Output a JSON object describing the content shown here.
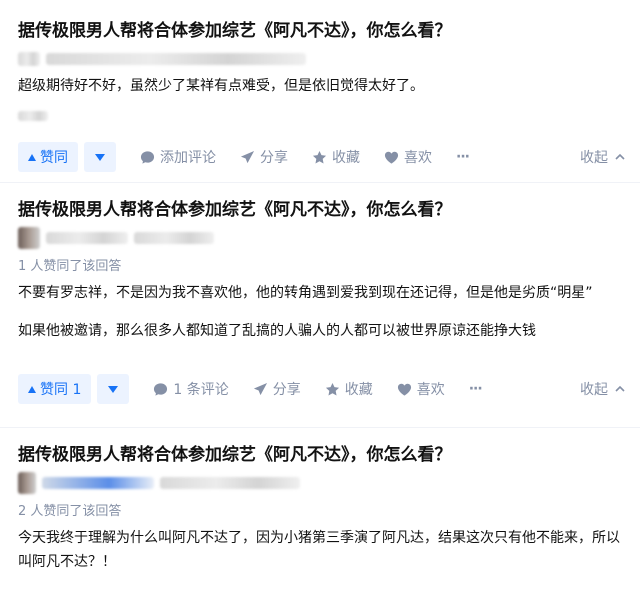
{
  "cards": [
    {
      "question": "据传极限男人帮将合体参加综艺《阿凡不达》，你怎么看？",
      "voters": "",
      "content": [
        "超级期待好不好，虽然少了某祥有点难受，但是依旧觉得太好了。"
      ],
      "actions": {
        "upvote": "赞同",
        "comment": "添加评论",
        "share": "分享",
        "favorite": "收藏",
        "like": "喜欢",
        "more": "···",
        "collapse": "收起"
      }
    },
    {
      "question": "据传极限男人帮将合体参加综艺《阿凡不达》，你怎么看？",
      "voters": "1 人赞同了该回答",
      "content": [
        "不要有罗志祥，不是因为我不喜欢他，他的转角遇到爱我到现在还记得，但是他是劣质“明星”",
        "如果他被邀请，那么很多人都知道了乱搞的人骗人的人都可以被世界原谅还能挣大钱"
      ],
      "actions": {
        "upvote": "赞同 1",
        "comment": "1 条评论",
        "share": "分享",
        "favorite": "收藏",
        "like": "喜欢",
        "more": "···",
        "collapse": "收起"
      }
    },
    {
      "question": "据传极限男人帮将合体参加综艺《阿凡不达》，你怎么看？",
      "voters": "2 人赞同了该回答",
      "content": [
        "今天我终于理解为什么叫阿凡不达了，因为小猪第三季演了阿凡达，结果这次只有他不能来，所以",
        "叫阿凡不达？！"
      ]
    }
  ],
  "colors": {
    "accent": "#1772f6",
    "accent_bg": "#ecf3ff",
    "meta": "#8590a6",
    "text": "#121212"
  }
}
